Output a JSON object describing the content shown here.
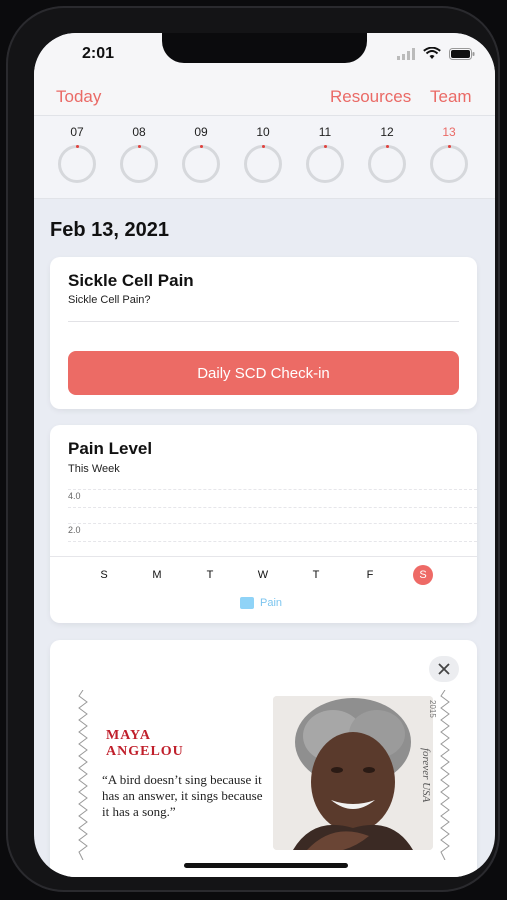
{
  "status": {
    "time": "2:01"
  },
  "nav": {
    "today": "Today",
    "resources": "Resources",
    "team": "Team"
  },
  "week": {
    "days": [
      "07",
      "08",
      "09",
      "10",
      "11",
      "12",
      "13"
    ],
    "selected_index": 6
  },
  "date_title": "Feb 13, 2021",
  "checkin_card": {
    "title": "Sickle Cell Pain",
    "subtitle": "Sickle Cell Pain?",
    "button_label": "Daily SCD Check-in"
  },
  "pain_card": {
    "title": "Pain Level",
    "subtitle": "This Week",
    "y_ticks": [
      "4.0",
      "2.0"
    ],
    "weekdays": [
      "S",
      "M",
      "T",
      "W",
      "T",
      "F",
      "S"
    ],
    "selected_weekday_index": 6,
    "legend": "Pain"
  },
  "chart_data": {
    "type": "bar",
    "title": "Pain Level",
    "subtitle": "This Week",
    "categories": [
      "S",
      "M",
      "T",
      "W",
      "T",
      "F",
      "S"
    ],
    "series": [
      {
        "name": "Pain",
        "values": [
          null,
          null,
          null,
          null,
          null,
          null,
          null
        ]
      }
    ],
    "ylabel": "",
    "y_ticks": [
      4.0,
      2.0
    ],
    "legend_position": "bottom"
  },
  "quote_card": {
    "name_line1": "MAYA",
    "name_line2": "ANGELOU",
    "quote": "“A bird doesn’t sing because it has an answer, it sings because it has a song.”",
    "year": "2015",
    "signature": "forever USA"
  },
  "colors": {
    "accent": "#ec6b65",
    "accent_text": "#ea6a66",
    "legend": "#8fd3f7",
    "stamp_red": "#c01f2b"
  }
}
